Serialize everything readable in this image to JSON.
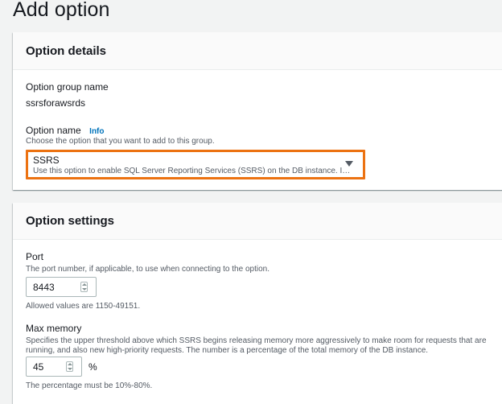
{
  "page": {
    "title": "Add option"
  },
  "option_details": {
    "header": "Option details",
    "group_name_label": "Option group name",
    "group_name_value": "ssrsforawsrds",
    "option_name_label": "Option name",
    "option_name_info": "Info",
    "option_name_description": "Choose the option that you want to add to this group.",
    "option_select": {
      "selected": "SSRS",
      "selected_description": "Use this option to enable SQL Server Reporting Services (SSRS) on the DB instance. I…"
    }
  },
  "option_settings": {
    "header": "Option settings",
    "port": {
      "label": "Port",
      "description": "The port number, if applicable, to use when connecting to the option.",
      "value": "8443",
      "constraint": "Allowed values are 1150-49151."
    },
    "max_memory": {
      "label": "Max memory",
      "description_line1": "Specifies the upper threshold above which SSRS begins releasing memory more aggressively to make room for requests that are",
      "description_line2": "running, and also new high-priority requests. The number is a percentage of the total memory of the DB instance.",
      "value": "45",
      "unit": "%",
      "constraint": "The percentage must be 10%-80%."
    }
  },
  "colors": {
    "focus_border": "#ec7211",
    "info_link": "#0073bb",
    "background": "#f2f3f3"
  },
  "icons": {
    "select_caret": "caret-down-icon",
    "stepper": "number-stepper-icon"
  }
}
